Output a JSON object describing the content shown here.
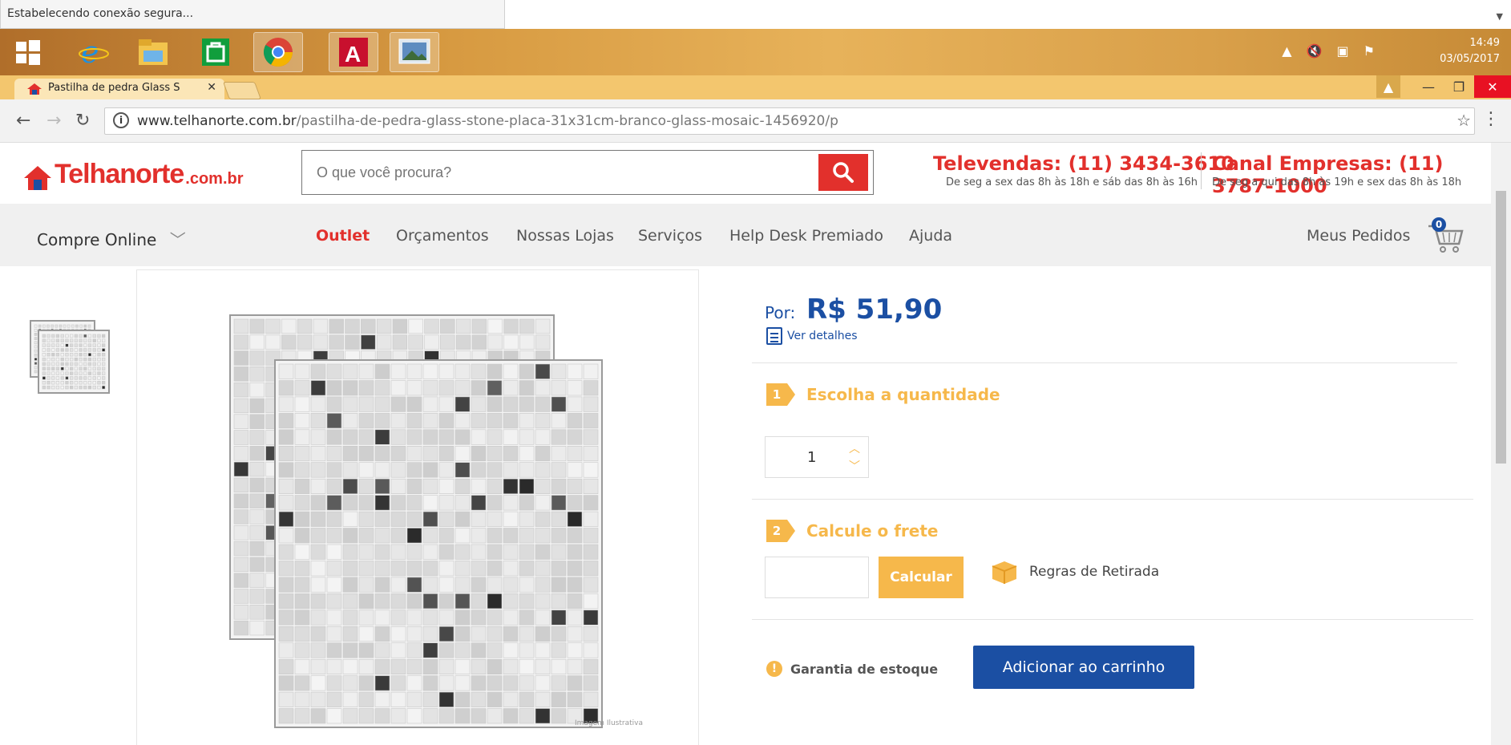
{
  "status_bar": {
    "text": "Estabelecendo conexão segura..."
  },
  "taskbar": {
    "apps": [
      "windows-start",
      "internet-explorer",
      "file-explorer",
      "store",
      "chrome",
      "autocad",
      "photos"
    ],
    "clock": {
      "time": "14:49",
      "date": "03/05/2017"
    }
  },
  "browser": {
    "tab_title": "Pastilha de pedra Glass S",
    "url_host": "www.telhanorte.com.br",
    "url_path": "/pastilha-de-pedra-glass-stone-placa-31x31cm-branco-glass-mosaic-1456920/p"
  },
  "site": {
    "logo": {
      "name": "Telhanorte",
      "suffix": ".com.br"
    },
    "search": {
      "placeholder": "O que você procura?"
    },
    "televendas": {
      "title": "Televendas: (11) 3434-3610",
      "hours": "De seg a sex das 8h às 18h e sáb das 8h às 16h"
    },
    "empresas": {
      "title": "Canal Empresas: (11) 3787-1000",
      "hours": "De seg a qui das 8h às 19h e sex das 8h às 18h"
    },
    "nav": {
      "buy_online": "Compre Online",
      "items": [
        "Outlet",
        "Orçamentos",
        "Nossas Lojas",
        "Serviços",
        "Help Desk Premiado",
        "Ajuda"
      ],
      "orders": "Meus Pedidos",
      "cart_count": "0"
    }
  },
  "product": {
    "image_caption": "Imagem Ilustrativa",
    "price_label": "Por:",
    "price": "R$ 51,90",
    "details_link": "Ver detalhes",
    "step1": {
      "num": "1",
      "title": "Escolha a quantidade"
    },
    "quantity": "1",
    "step2": {
      "num": "2",
      "title": "Calcule o frete"
    },
    "calc_button": "Calcular",
    "pickup_rules": "Regras de Retirada",
    "stock_guarantee": "Garantia de estoque",
    "add_to_cart": "Adicionar ao carrinho"
  },
  "colors": {
    "brand_red": "#e2302c",
    "brand_blue": "#1b4fa3",
    "accent_orange": "#f6b84b"
  }
}
